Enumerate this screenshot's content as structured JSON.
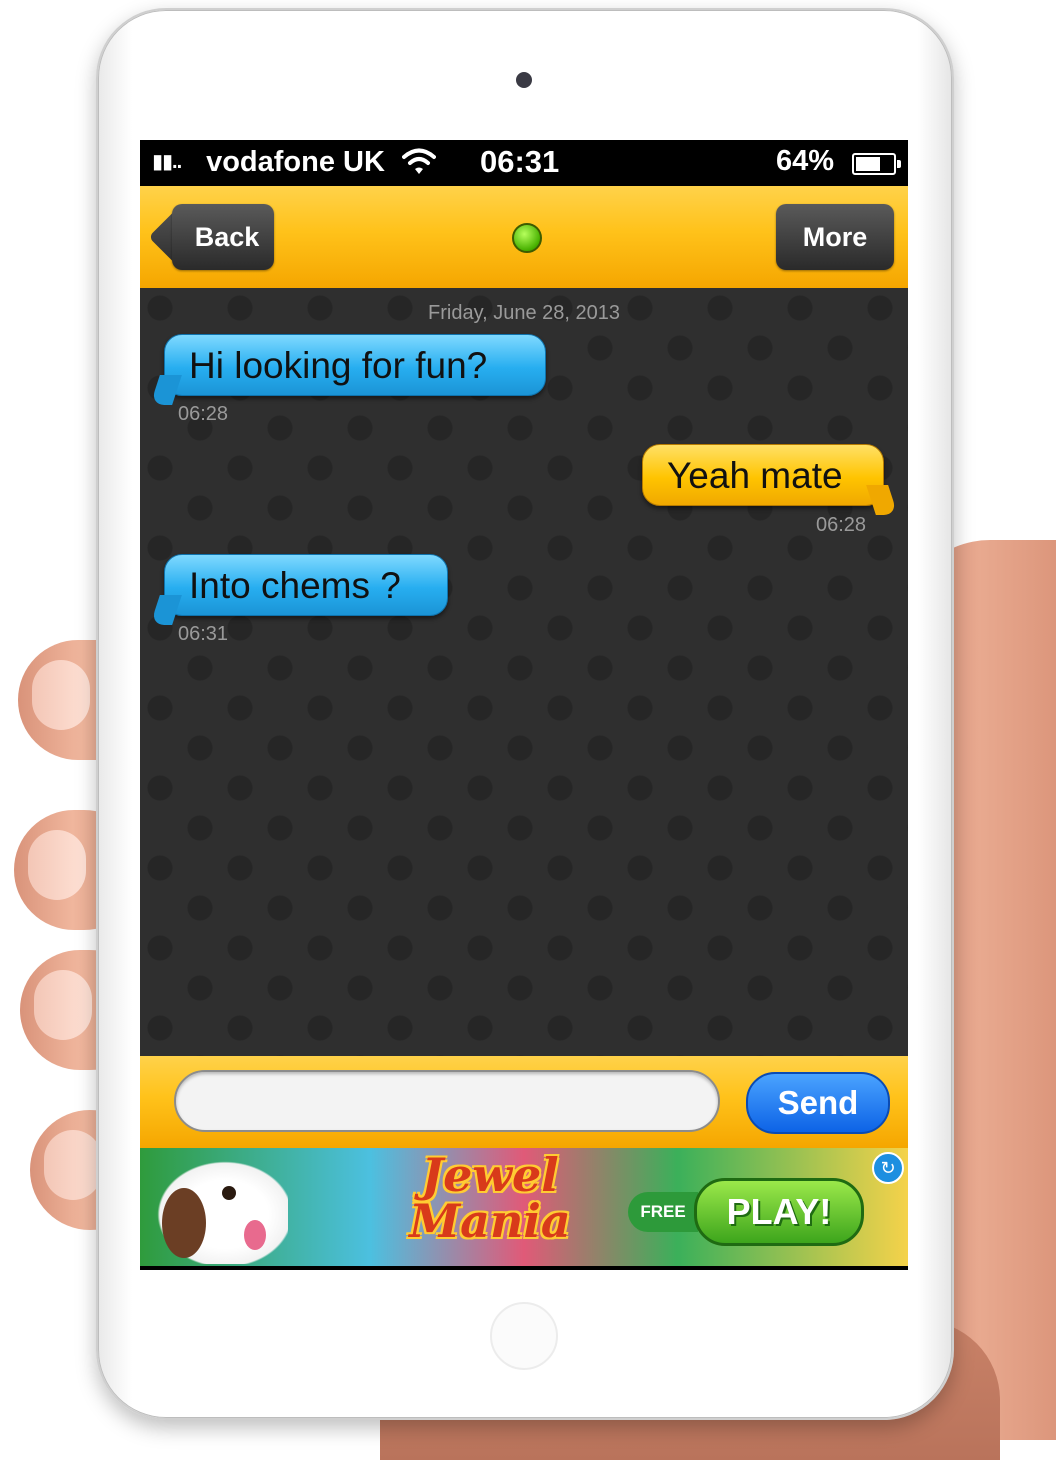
{
  "status_bar": {
    "signal": "▮▮..",
    "carrier": "vodafone UK",
    "time": "06:31",
    "battery_percent": "64%"
  },
  "nav": {
    "back_label": "Back",
    "more_label": "More",
    "online_color": "#47b000"
  },
  "chat": {
    "date_header": "Friday, June 28, 2013",
    "messages": [
      {
        "direction": "in",
        "text": "Hi looking for fun?",
        "time": "06:28"
      },
      {
        "direction": "out",
        "text": "Yeah mate",
        "time": "06:28"
      },
      {
        "direction": "in",
        "text": "Into chems ?",
        "time": "06:31"
      }
    ]
  },
  "compose": {
    "input_value": "",
    "input_placeholder": "",
    "send_label": "Send"
  },
  "ad": {
    "title_line1": "Jewel",
    "title_line2": "Mania",
    "free_label": "FREE",
    "play_label": "PLAY!"
  },
  "colors": {
    "accent": "#ffc21a",
    "incoming_bubble": "#27aef0",
    "outgoing_bubble": "#ffc400",
    "send_button": "#0d63e6"
  }
}
